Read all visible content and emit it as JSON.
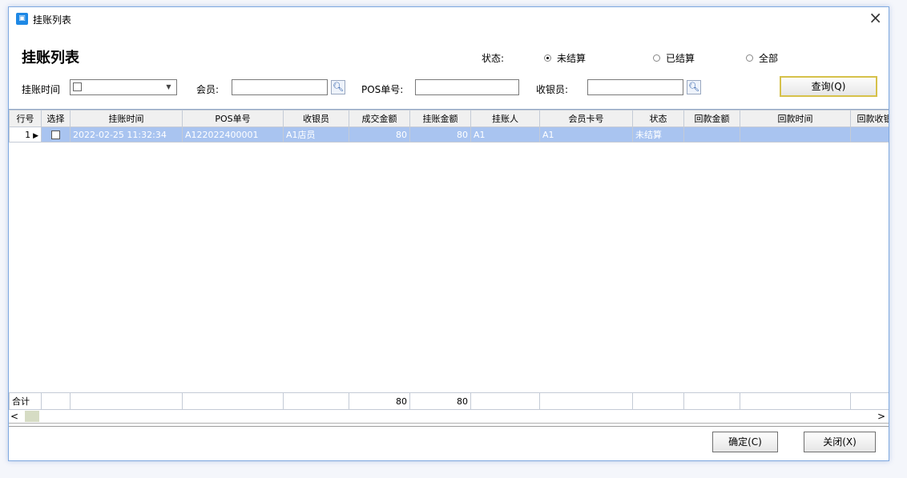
{
  "window": {
    "title": "挂账列表",
    "icon": "app-icon",
    "close": "×"
  },
  "page_title": "挂账列表",
  "status": {
    "label": "状态:",
    "options": [
      {
        "label": "未结算",
        "checked": true
      },
      {
        "label": "已结算",
        "checked": false
      },
      {
        "label": "全部",
        "checked": false
      }
    ]
  },
  "filters": {
    "date_label": "挂账时间",
    "member_label": "会员:",
    "member_value": "",
    "pos_label": "POS单号:",
    "pos_value": "",
    "cashier_label": "收银员:",
    "cashier_value": "",
    "query_button": "查询(Q)"
  },
  "table": {
    "columns": [
      "行号",
      "选择",
      "挂账时间",
      "POS单号",
      "收银员",
      "成交金额",
      "挂账金额",
      "挂账人",
      "会员卡号",
      "状态",
      "回款金额",
      "回款时间",
      "回款收银"
    ],
    "rows": [
      {
        "row_no": "1",
        "time": "2022-02-25 11:32:34",
        "pos_no": "A122022400001",
        "cashier": "A1店员",
        "deal_amount": "80",
        "credit_amount": "80",
        "credit_person": "A1",
        "member_card": "A1",
        "status": "未结算",
        "refund_amount": "",
        "refund_time": "",
        "refund_cashier": ""
      }
    ],
    "totals": {
      "label": "合计",
      "deal_amount": "80",
      "credit_amount": "80"
    }
  },
  "buttons": {
    "confirm": "确定(C)",
    "close": "关闭(X)"
  },
  "colors": {
    "selected_row": "#a9c4f0",
    "window_border": "#7fa9e0",
    "accent_icon": "#1e88e5"
  }
}
